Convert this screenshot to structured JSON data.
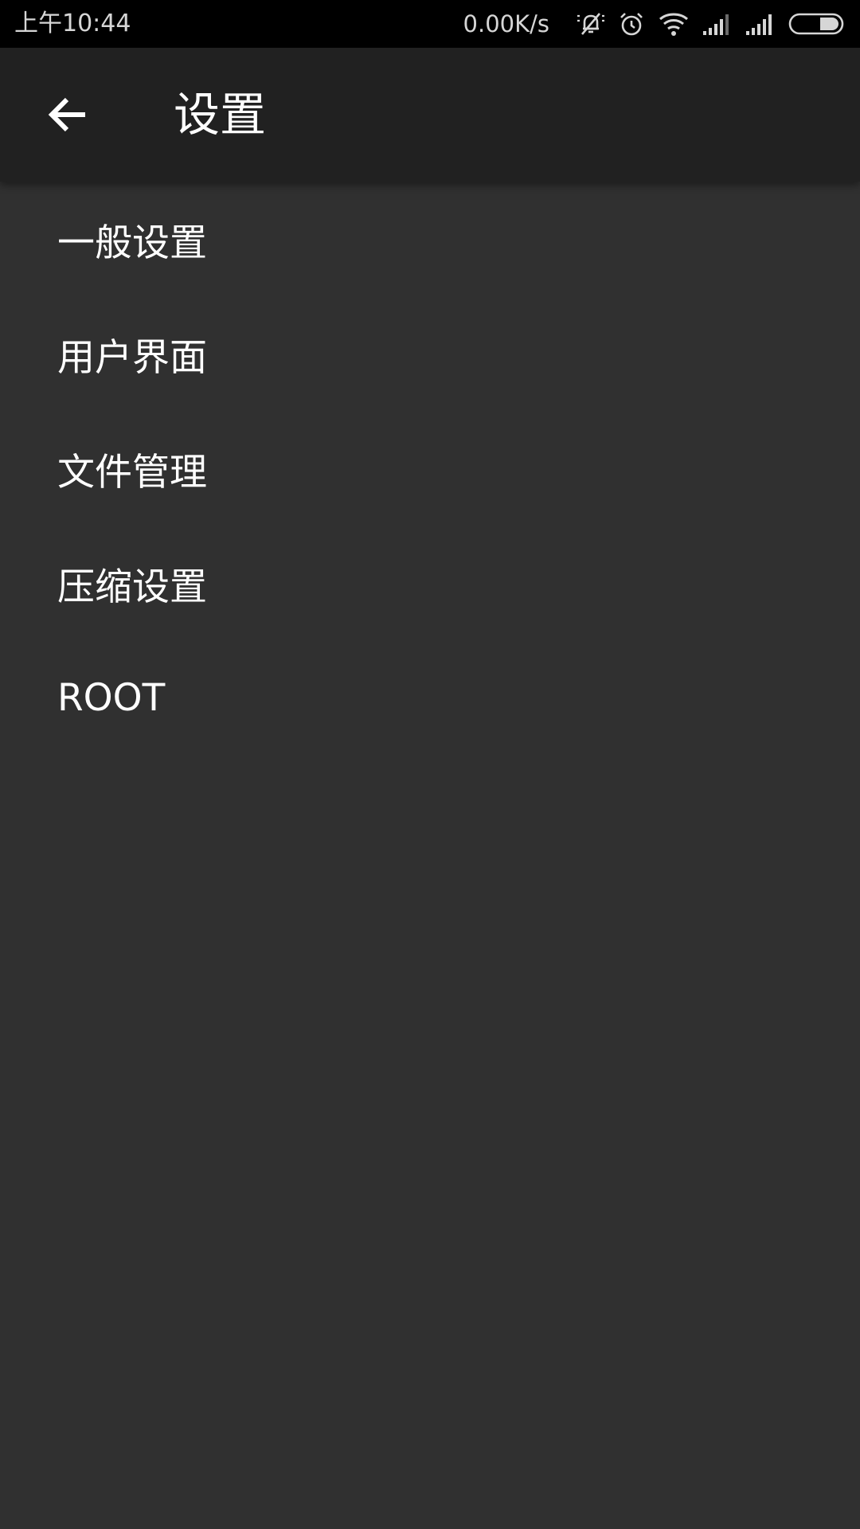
{
  "status_bar": {
    "time": "上午10:44",
    "net_speed": "0.00K/s",
    "icons": [
      "bell-muted-icon",
      "alarm-icon",
      "wifi-icon",
      "signal-icon",
      "signal-icon",
      "battery-icon"
    ]
  },
  "app_bar": {
    "back_icon": "arrow-left-icon",
    "title": "设置"
  },
  "settings": {
    "items": [
      {
        "label": "一般设置"
      },
      {
        "label": "用户界面"
      },
      {
        "label": "文件管理"
      },
      {
        "label": "压缩设置"
      },
      {
        "label": "ROOT"
      }
    ]
  },
  "colors": {
    "status_bar_bg": "#000000",
    "app_bar_bg": "#212121",
    "content_bg": "#303030",
    "text": "#ffffff"
  }
}
